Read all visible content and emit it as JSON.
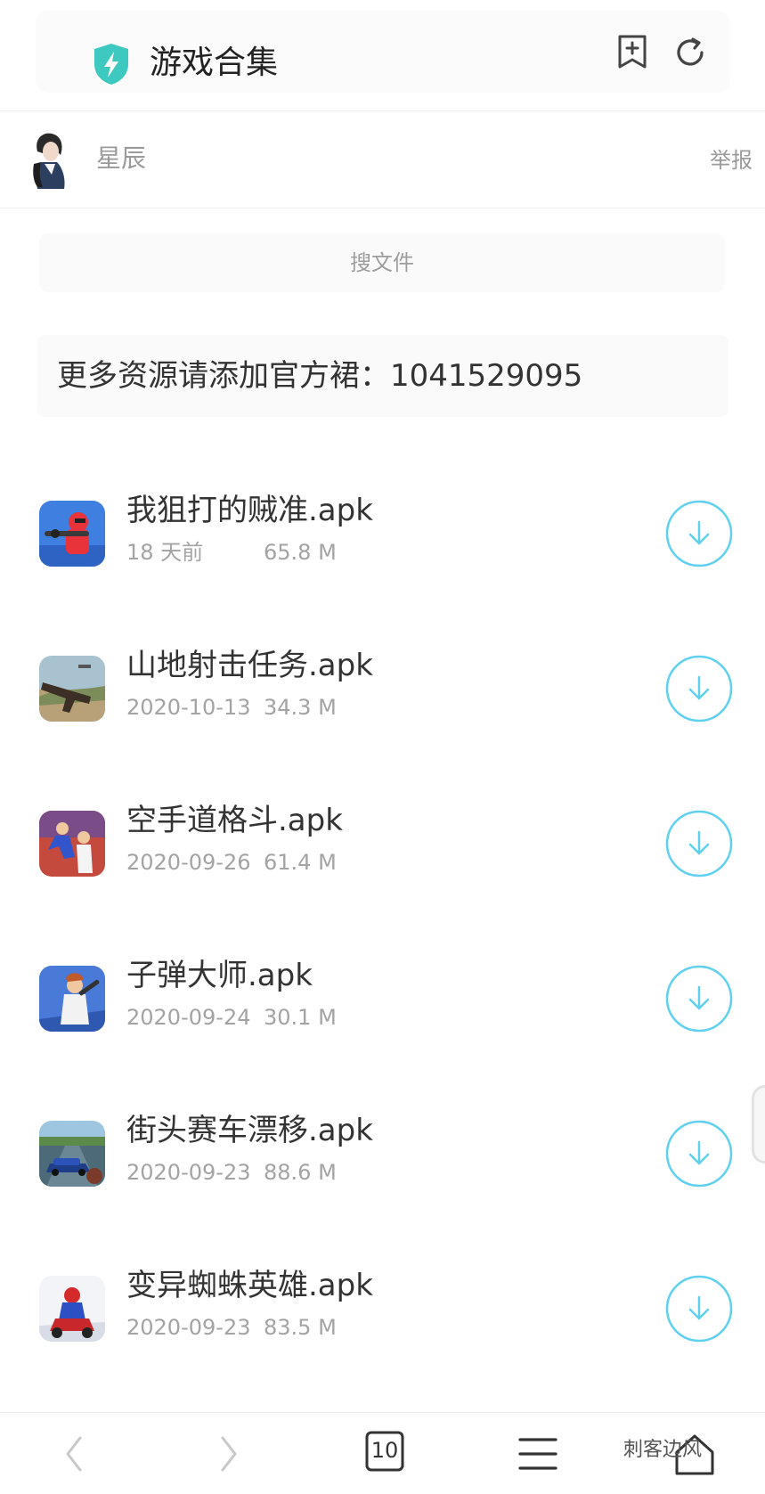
{
  "header": {
    "title": "游戏合集",
    "accent": "#3dc9c0"
  },
  "user": {
    "name": "星辰",
    "report_label": "举报"
  },
  "search": {
    "label": "搜文件"
  },
  "notice": {
    "text": "更多资源请添加官方裙：1041529095"
  },
  "files": [
    {
      "name": "我狙打的贼准.apk",
      "date": "18 天前",
      "size": "65.8 M",
      "icon": "sniper-game-icon"
    },
    {
      "name": "山地射击任务.apk",
      "date": "2020-10-13",
      "size": "34.3 M",
      "icon": "rifle-game-icon"
    },
    {
      "name": "空手道格斗.apk",
      "date": "2020-09-26",
      "size": "61.4 M",
      "icon": "karate-game-icon"
    },
    {
      "name": "子弹大师.apk",
      "date": "2020-09-24",
      "size": "30.1 M",
      "icon": "bullet-master-game-icon"
    },
    {
      "name": "街头赛车漂移.apk",
      "date": "2020-09-23",
      "size": "88.6 M",
      "icon": "racing-game-icon"
    },
    {
      "name": "变异蜘蛛英雄.apk",
      "date": "2020-09-23",
      "size": "83.5 M",
      "icon": "spider-hero-game-icon"
    }
  ],
  "download_color": "#5fd0f0",
  "bottom_nav": {
    "tab_count": "10",
    "watermark": "刺客边风"
  }
}
